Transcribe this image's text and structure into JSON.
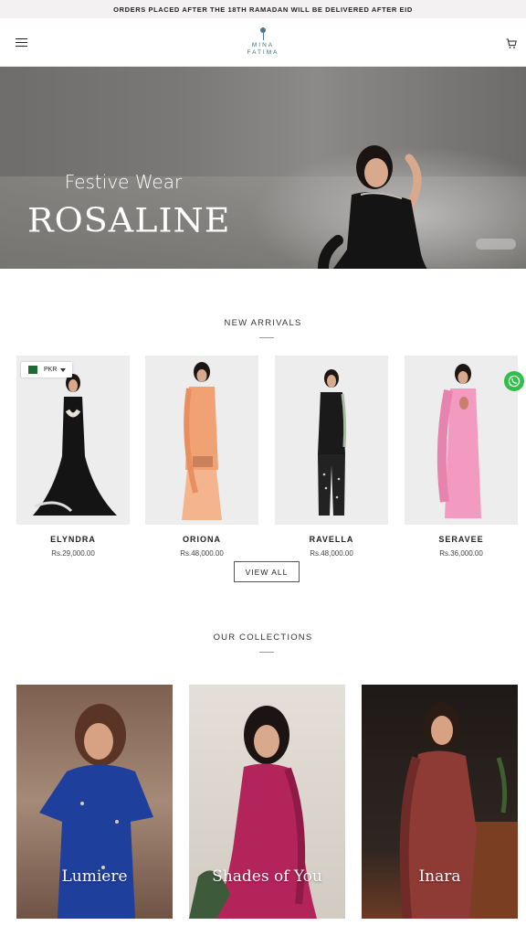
{
  "announcement": "ORDERS PLACED AFTER THE 18TH RAMADAN WILL BE DELIVERED AFTER EID",
  "header": {
    "logo_line1": "MINA",
    "logo_line2": "FATIMA",
    "menu_icon": "hamburger-menu-icon",
    "cart_icon": "shopping-cart-icon"
  },
  "hero": {
    "title": "ROSALINE",
    "subtitle": "Festive Wear"
  },
  "new_arrivals": {
    "title": "NEW ARRIVALS",
    "currency": "PKR",
    "products": [
      {
        "name": "ELYNDRA",
        "price": "Rs.29,000.00",
        "dress_color": "#141414"
      },
      {
        "name": "ORIONA",
        "price": "Rs.48,000.00",
        "dress_color": "#f0a274"
      },
      {
        "name": "RAVELLA",
        "price": "Rs.48,000.00",
        "dress_color": "#1a1a1a"
      },
      {
        "name": "SERAVEE",
        "price": "Rs.36,000.00",
        "dress_color": "#f29ac0"
      }
    ],
    "view_all_label": "VIEW ALL"
  },
  "collections": {
    "title": "OUR COLLECTIONS",
    "items": [
      {
        "name": "Lumiere",
        "bg": "#8c6e5e",
        "dress_color": "#1f3f9c"
      },
      {
        "name": "Shades of You",
        "bg": "#d9d3cc",
        "dress_color": "#b3245a"
      },
      {
        "name": "Inara",
        "bg": "#2a2320",
        "dress_color": "#8e3a35"
      }
    ]
  },
  "colors": {
    "accent_logo": "#3d6b7a",
    "whatsapp": "#2fbf4a"
  }
}
